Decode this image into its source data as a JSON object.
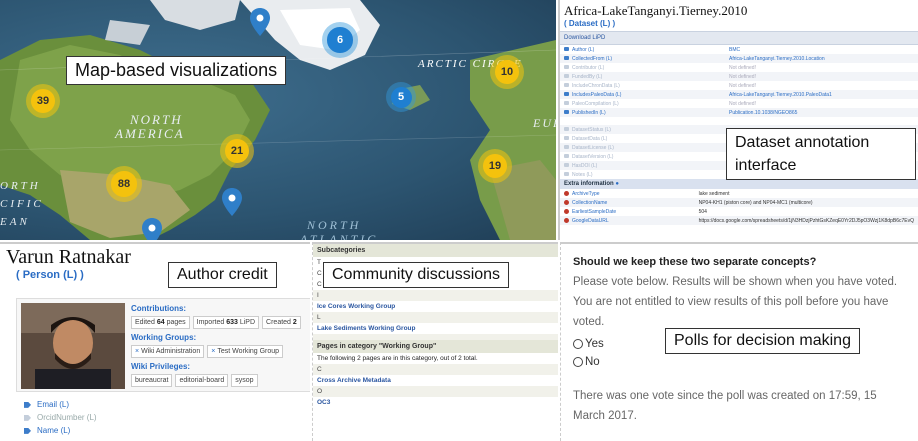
{
  "map": {
    "callout": "Map-based visualizations",
    "labels": {
      "arctic": "ARCTIC CIRCLE",
      "north": "NORTH",
      "america": "AMERICA",
      "north_atlantic_1": "NORTH",
      "north_atlantic_2": "ATLANTIC",
      "eur": "EUR",
      "orth": "ORTH",
      "cific": "CIFIC",
      "ean": "EAN"
    },
    "clusters": [
      {
        "count": "6",
        "color": "blue"
      },
      {
        "count": "10",
        "color": "yellow"
      },
      {
        "count": "39",
        "color": "yellow"
      },
      {
        "count": "5",
        "color": "blue"
      },
      {
        "count": "21",
        "color": "yellow"
      },
      {
        "count": "88",
        "color": "yellow"
      },
      {
        "count": "19",
        "color": "yellow"
      }
    ],
    "colors": {
      "cluster_yellow": "#f4c20d",
      "cluster_blue": "#1f7fd1",
      "pin": "#2f7fc9"
    }
  },
  "dataset": {
    "title": "Africa-LakeTanganyi.Tierney.2010",
    "type": "( Dataset (L) )",
    "download": "Download LiPD",
    "callout_line1": "Dataset annotation",
    "callout_line2": "interface",
    "rows": [
      {
        "k": "Author (L)",
        "v": "BMC",
        "dim": false
      },
      {
        "k": "CollectedFrom (L)",
        "v": "Africa-LakeTanganyi.Tierney.2010.Location",
        "dim": false
      },
      {
        "k": "Contributor (L)",
        "v": "Not defined!",
        "dim": true
      },
      {
        "k": "FundedBy (L)",
        "v": "Not defined!",
        "dim": true
      },
      {
        "k": "IncludeChronData (L)",
        "v": "Not defined!",
        "dim": true
      },
      {
        "k": "IncludesPaleoData (L)",
        "v": "Africa-LakeTanganyi.Tierney.2010.PaleoData1",
        "dim": false
      },
      {
        "k": "PaleoCompilation (L)",
        "v": "Not defined!",
        "dim": true
      },
      {
        "k": "PublishedIn (L)",
        "v": "Publication.10.1038/NGEO865",
        "dim": false
      },
      {
        "k": "",
        "v": "",
        "dim": true
      },
      {
        "k": "DatasetStatus (L)",
        "v": "",
        "dim": true
      },
      {
        "k": "DatasetData (L)",
        "v": "",
        "dim": true
      },
      {
        "k": "DatasetLicense (L)",
        "v": "",
        "dim": true
      },
      {
        "k": "DatasetVersion (L)",
        "v": "",
        "dim": true
      },
      {
        "k": "HasDOI (L)",
        "v": "",
        "dim": true
      },
      {
        "k": "Notes (L)",
        "v": "",
        "dim": true
      }
    ],
    "extra_label": "Extra information",
    "extra_rows": [
      {
        "k": "ArchiveType",
        "v": "lake sediment"
      },
      {
        "k": "CollectionName",
        "v": "NP04-KH1 (piston core) and NP04-MC1 (multicore)"
      },
      {
        "k": "EarliestSampleDate",
        "v": "504"
      },
      {
        "k": "GoogleDataURL",
        "v": "https://docs.google.com/spreadsheets/d/1jN3HDzjPzhtGsKZeqE0Yr2DJ5pO3Wzj1K8dpB6c7EvQ"
      }
    ]
  },
  "person": {
    "name": "Varun Ratnakar",
    "type": "( Person (L) )",
    "callout": "Author credit",
    "contributions_label": "Contributions:",
    "edited_prefix": "Edited",
    "edited_count": "64",
    "edited_suffix": "pages",
    "imported_prefix": "Imported",
    "imported_count": "633",
    "imported_suffix": "LiPD",
    "created_prefix": "Created",
    "created_count": "2",
    "working_groups_label": "Working Groups:",
    "groups": [
      "Wiki Administration",
      "Test Working Group"
    ],
    "privileges_label": "Wiki Privileges:",
    "privileges": [
      "bureaucrat",
      "editorial-board",
      "sysop"
    ],
    "links": [
      {
        "label": "Email (L)",
        "dim": false
      },
      {
        "label": "OrcidNumber (L)",
        "dim": true
      },
      {
        "label": "Name (L)",
        "dim": false
      }
    ]
  },
  "community": {
    "callout": "Community discussions",
    "subcategories": "Subcategories",
    "letter_t": "T",
    "letter_c1": "C",
    "letter_c2": "C",
    "letter_i": "I",
    "item_ice": "Ice Cores Working Group",
    "letter_l": "L",
    "item_lake": "Lake Sediments Working Group",
    "pages_header": "Pages in category \"Working Group\"",
    "pages_text": "The following 2 pages are in this category, out of 2 total.",
    "letter_c3": "C",
    "item_cross": "Cross Archive Metadata",
    "letter_o": "O",
    "item_oc3": "OC3"
  },
  "poll": {
    "question": "Should we keep these two separate concepts?",
    "text1": "Please vote below. Results will be shown when you have voted.",
    "text2": "You are not entitled to view results of this poll before you have voted.",
    "options": [
      "Yes",
      "No"
    ],
    "callout": "Polls for decision making",
    "footer": "There was one vote since the poll was created on 17:59, 15 March 2017."
  }
}
